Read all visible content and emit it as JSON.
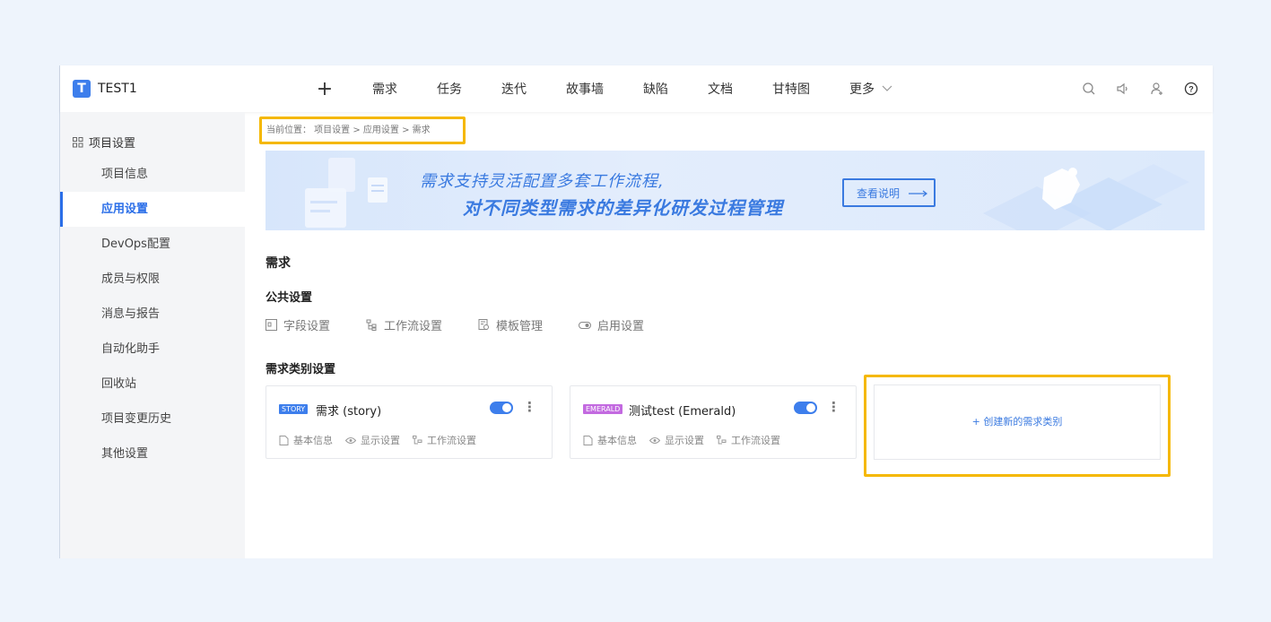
{
  "header": {
    "logo_letter": "T",
    "project_name": "TEST1",
    "plus_label": "+",
    "nav": [
      "需求",
      "任务",
      "迭代",
      "故事墙",
      "缺陷",
      "文档",
      "甘特图",
      "更多"
    ],
    "icons": [
      "search-icon",
      "speaker-icon",
      "user-add-icon",
      "help-icon"
    ]
  },
  "sidebar": {
    "heading": "项目设置",
    "items": [
      {
        "label": "项目信息",
        "active": false
      },
      {
        "label": "应用设置",
        "active": true
      },
      {
        "label": "DevOps配置",
        "active": false
      },
      {
        "label": "成员与权限",
        "active": false
      },
      {
        "label": "消息与报告",
        "active": false
      },
      {
        "label": "自动化助手",
        "active": false
      },
      {
        "label": "回收站",
        "active": false
      },
      {
        "label": "项目变更历史",
        "active": false
      },
      {
        "label": "其他设置",
        "active": false
      }
    ]
  },
  "breadcrumb": "当前位置： 项目设置 > 应用设置 > 需求",
  "banner": {
    "line1": "需求支持灵活配置多套工作流程,",
    "line2": "对不同类型需求的差异化研发过程管理",
    "button": "查看说明"
  },
  "section": {
    "title": "需求",
    "public_title": "公共设置",
    "public_items": [
      "字段设置",
      "工作流设置",
      "模板管理",
      "启用设置"
    ],
    "types_title": "需求类别设置"
  },
  "cards": [
    {
      "tag": "STORY",
      "tag_color": "#3d7eec",
      "title": "需求 (story)",
      "enabled": true,
      "links": [
        "基本信息",
        "显示设置",
        "工作流设置"
      ]
    },
    {
      "tag": "EMERALD",
      "tag_color": "#c36ae0",
      "title": "测试test (Emerald)",
      "enabled": true,
      "links": [
        "基本信息",
        "显示设置",
        "工作流设置"
      ]
    }
  ],
  "create_label": "+ 创建新的需求类别",
  "colors": {
    "accent": "#3d7eec",
    "highlight": "#f5b800"
  }
}
